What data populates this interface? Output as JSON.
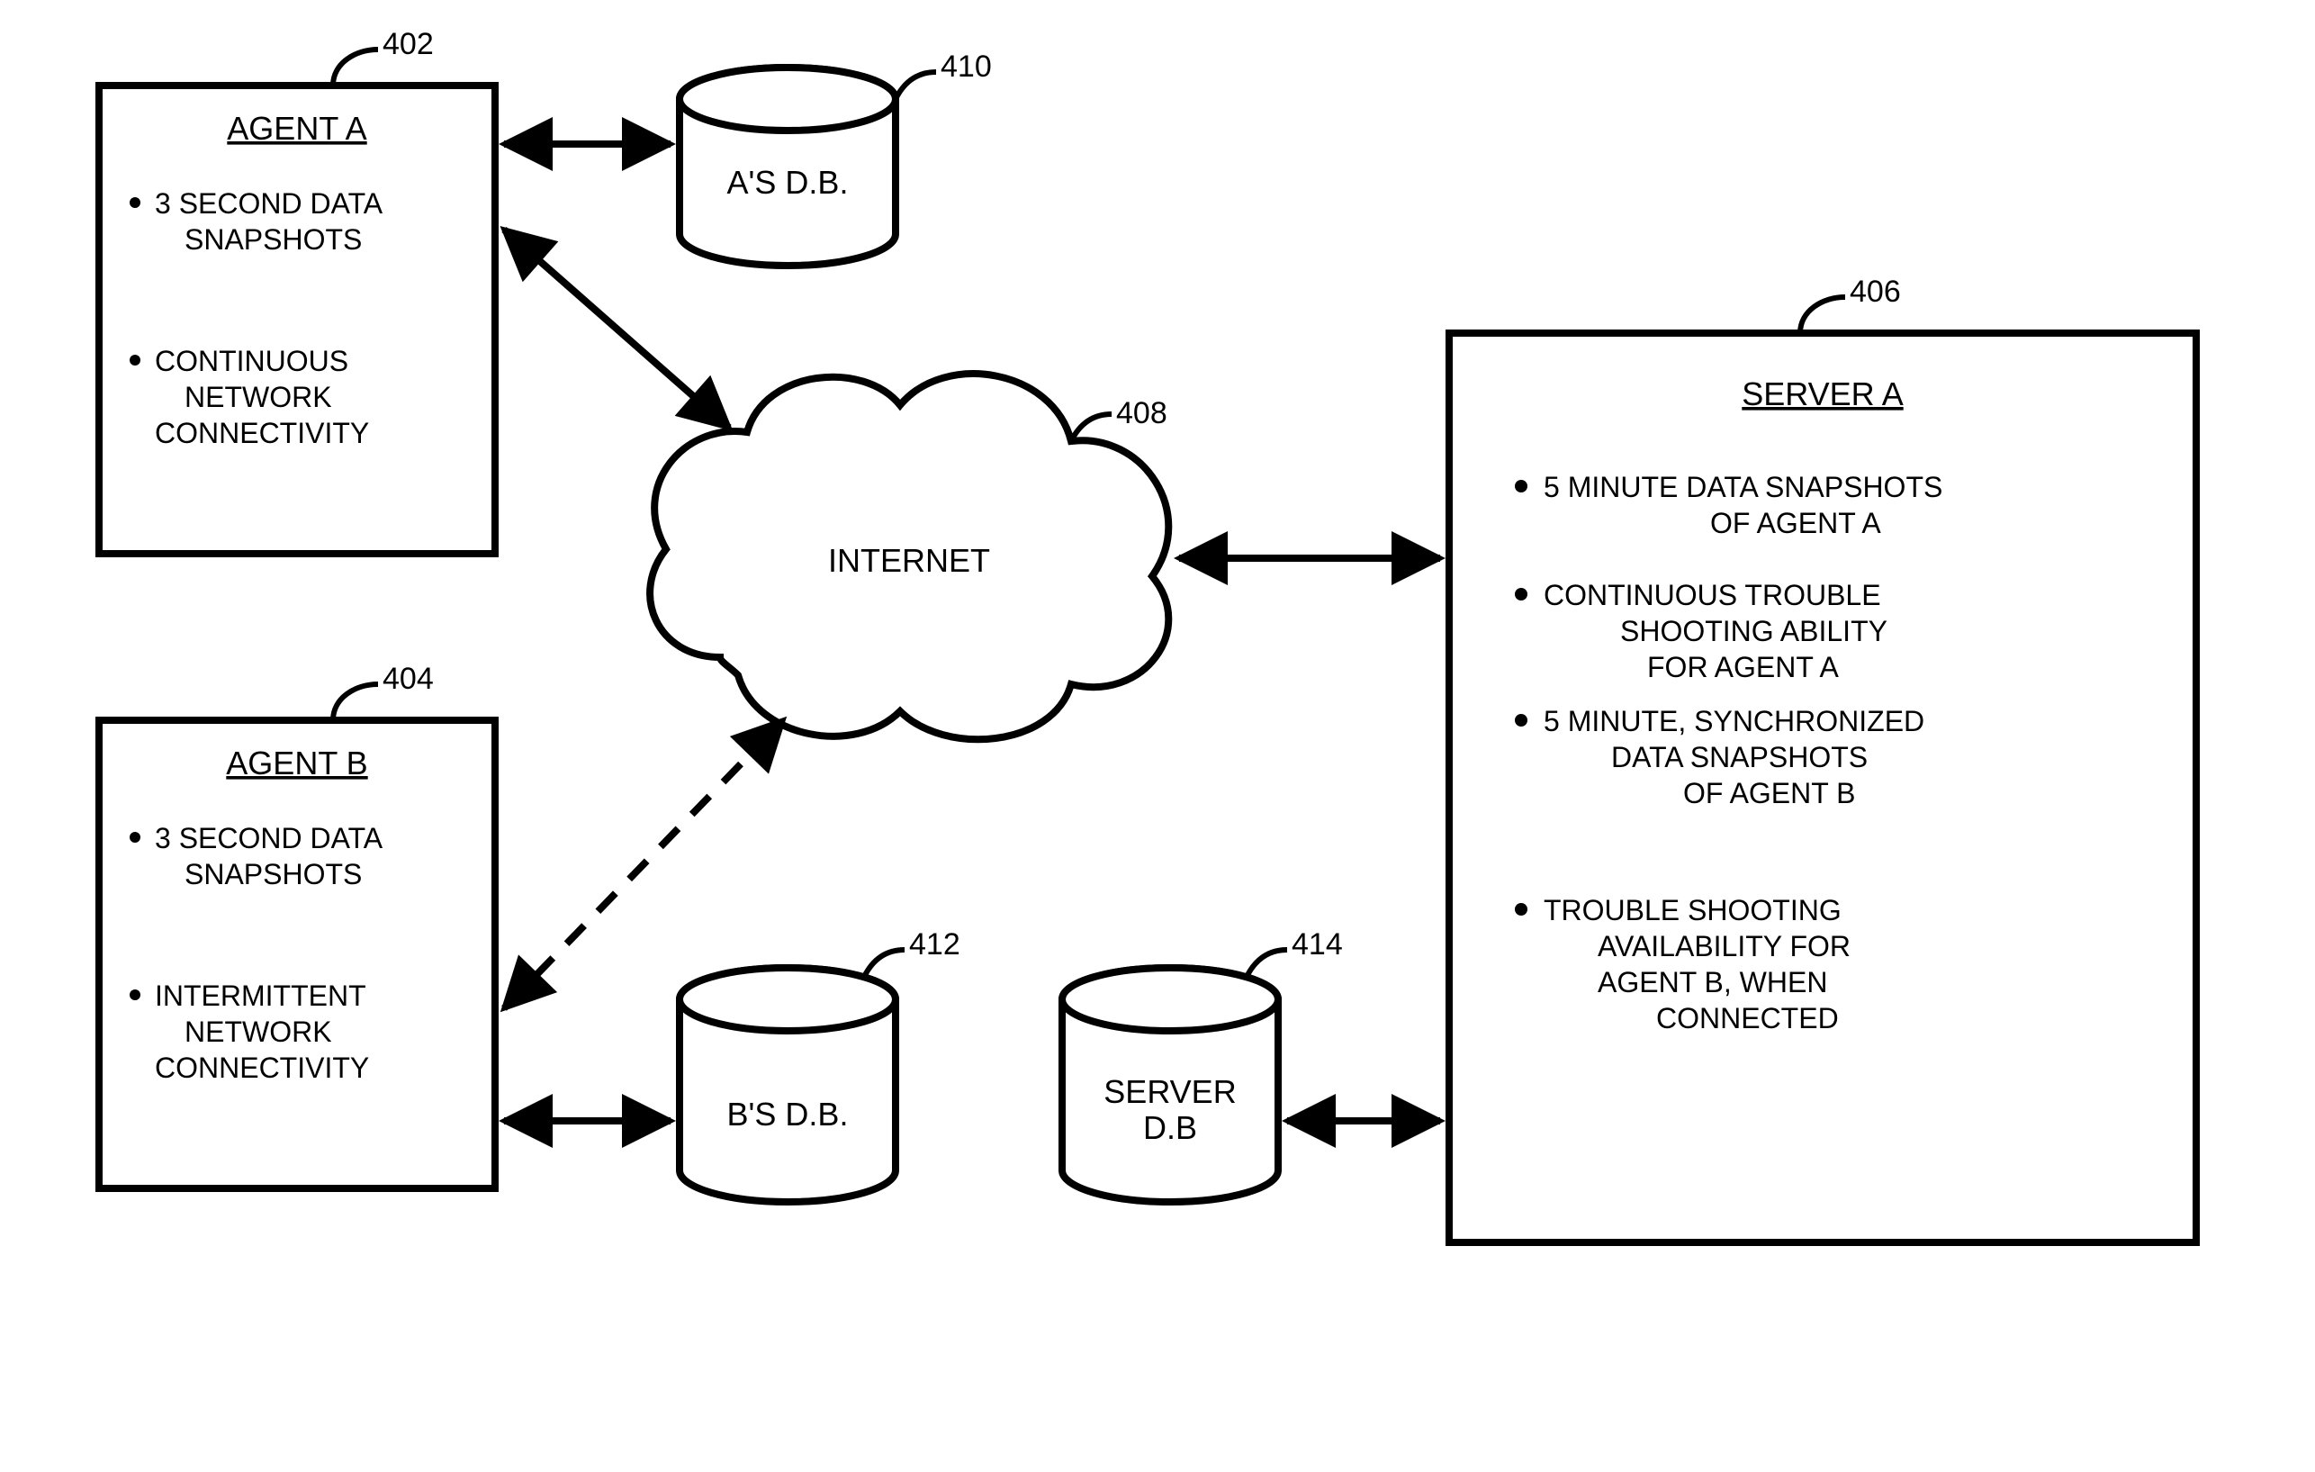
{
  "refs": {
    "agentA": "402",
    "agentB": "404",
    "server": "406",
    "cloud": "408",
    "dbA": "410",
    "dbB": "412",
    "dbServer": "414"
  },
  "agentA": {
    "title": "AGENT A",
    "b1l1": "3 SECOND DATA",
    "b1l2": "SNAPSHOTS",
    "b2l1": "CONTINUOUS",
    "b2l2": "NETWORK",
    "b2l3": "CONNECTIVITY"
  },
  "agentB": {
    "title": "AGENT B",
    "b1l1": "3 SECOND DATA",
    "b1l2": "SNAPSHOTS",
    "b2l1": "INTERMITTENT",
    "b2l2": "NETWORK",
    "b2l3": "CONNECTIVITY"
  },
  "server": {
    "title": "SERVER A",
    "b1l1": "5 MINUTE DATA SNAPSHOTS",
    "b1l2": "OF AGENT A",
    "b2l1": "CONTINUOUS TROUBLE",
    "b2l2": "SHOOTING ABILITY",
    "b2l3": "FOR AGENT A",
    "b3l1": "5 MINUTE, SYNCHRONIZED",
    "b3l2": "DATA SNAPSHOTS",
    "b3l3": "OF AGENT B",
    "b4l1": "TROUBLE SHOOTING",
    "b4l2": "AVAILABILITY FOR",
    "b4l3": "AGENT B,  WHEN",
    "b4l4": "CONNECTED"
  },
  "dbA": {
    "label": "A'S D.B."
  },
  "dbB": {
    "label": "B'S D.B."
  },
  "dbServer": {
    "l1": "SERVER",
    "l2": "D.B"
  },
  "cloud": {
    "label": "INTERNET"
  }
}
